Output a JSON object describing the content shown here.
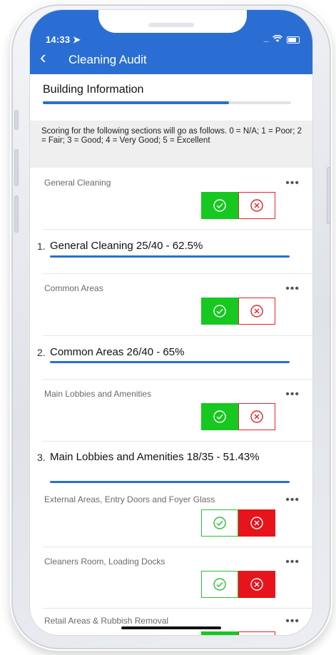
{
  "status_bar": {
    "time": "14:33 ➤",
    "signal": "....",
    "wifi_icon": "wifi-icon",
    "battery_icon": "battery-icon"
  },
  "header": {
    "back": "‹",
    "title": "Cleaning Audit",
    "color": "#2a6ed4"
  },
  "building_information": {
    "title": "Building Information",
    "progress": 0.75
  },
  "scoring_note": "Scoring for the following sections will go as follows. 0 = N/A; 1 = Poor; 2 = Fair; 3 = Good; 4 = Very Good; 5 = Excellent",
  "more_label": "•••",
  "items": [
    {
      "label": "General Cleaning",
      "state": "yes"
    },
    {
      "label": "Common Areas",
      "state": "yes"
    },
    {
      "label": "Main Lobbies and Amenities",
      "state": "yes"
    },
    {
      "label": "External Areas, Entry Doors and Foyer Glass",
      "state": "no"
    },
    {
      "label": "Cleaners Room, Loading Docks",
      "state": "no"
    },
    {
      "label": "Retail Areas & Rubbish Removal",
      "state": "yes"
    }
  ],
  "sections": [
    {
      "number": "1.",
      "title": "General Cleaning 25/40 - 62.5%"
    },
    {
      "number": "2.",
      "title": "Common Areas 26/40 - 65%"
    },
    {
      "number": "3.",
      "title": "Main Lobbies and Amenities 18/35 - 51.43%"
    }
  ],
  "colors": {
    "accent": "#2a6ed4",
    "yes": "#16c81f",
    "no": "#e8141c"
  }
}
